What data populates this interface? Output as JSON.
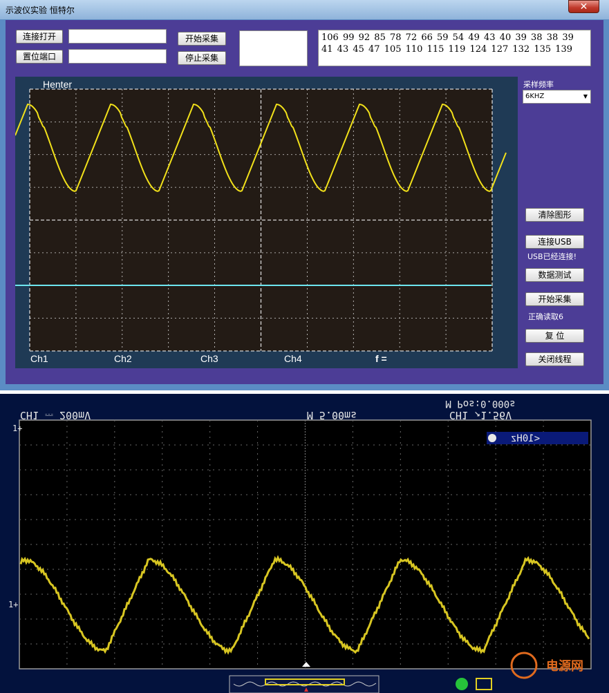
{
  "window": {
    "title": "示波仪实验  恒特尔",
    "close_glyph": "✕"
  },
  "controls": {
    "connect_open_label": "连接打开",
    "reset_port_label": "置位端口",
    "start_capture_label": "开始采集",
    "stop_capture_label": "停止采集",
    "connect_field_value": "",
    "reset_field_value": ""
  },
  "data_box": {
    "line1": "106  99  92  85  78  72  66  59  54  49  43  40  39  38  38  39",
    "line2": "41  43  45  47  105  110  115  119  124  127  132  135  139"
  },
  "scope": {
    "name": "Henter",
    "channels": [
      "Ch1",
      "Ch2",
      "Ch3",
      "Ch4"
    ],
    "freq_label": "f ="
  },
  "sidebar": {
    "sample_rate_label": "采样频率",
    "sample_rate_value": "6KHZ",
    "clear_button": "清除图形",
    "connect_usb_button": "连接USB",
    "usb_status": "USB已经连接!",
    "data_test_button": "数据测试",
    "start_capture_button": "开始采集",
    "read_status": "正确读取6",
    "reset_button": "复  位",
    "close_thread_button": "关闭线程"
  },
  "colors": {
    "window_frame": "#5b8cc4",
    "client_bg": "#4c3d96",
    "scope_bg": "#231b15",
    "trace_yellow": "#f2e11a",
    "trace_cyan": "#6ee6f0",
    "photo_bg": "#03123d"
  },
  "photo": {
    "ch1_scale": "CH1 ⎓ 200mV",
    "timebase": "M 5.00ms",
    "ch1_level": "CH1 ↗1.56V",
    "position": "M Pos:0.000s",
    "freq_readout": "<10Hz",
    "watermark": "电源网",
    "ch_marker": "1+"
  }
}
